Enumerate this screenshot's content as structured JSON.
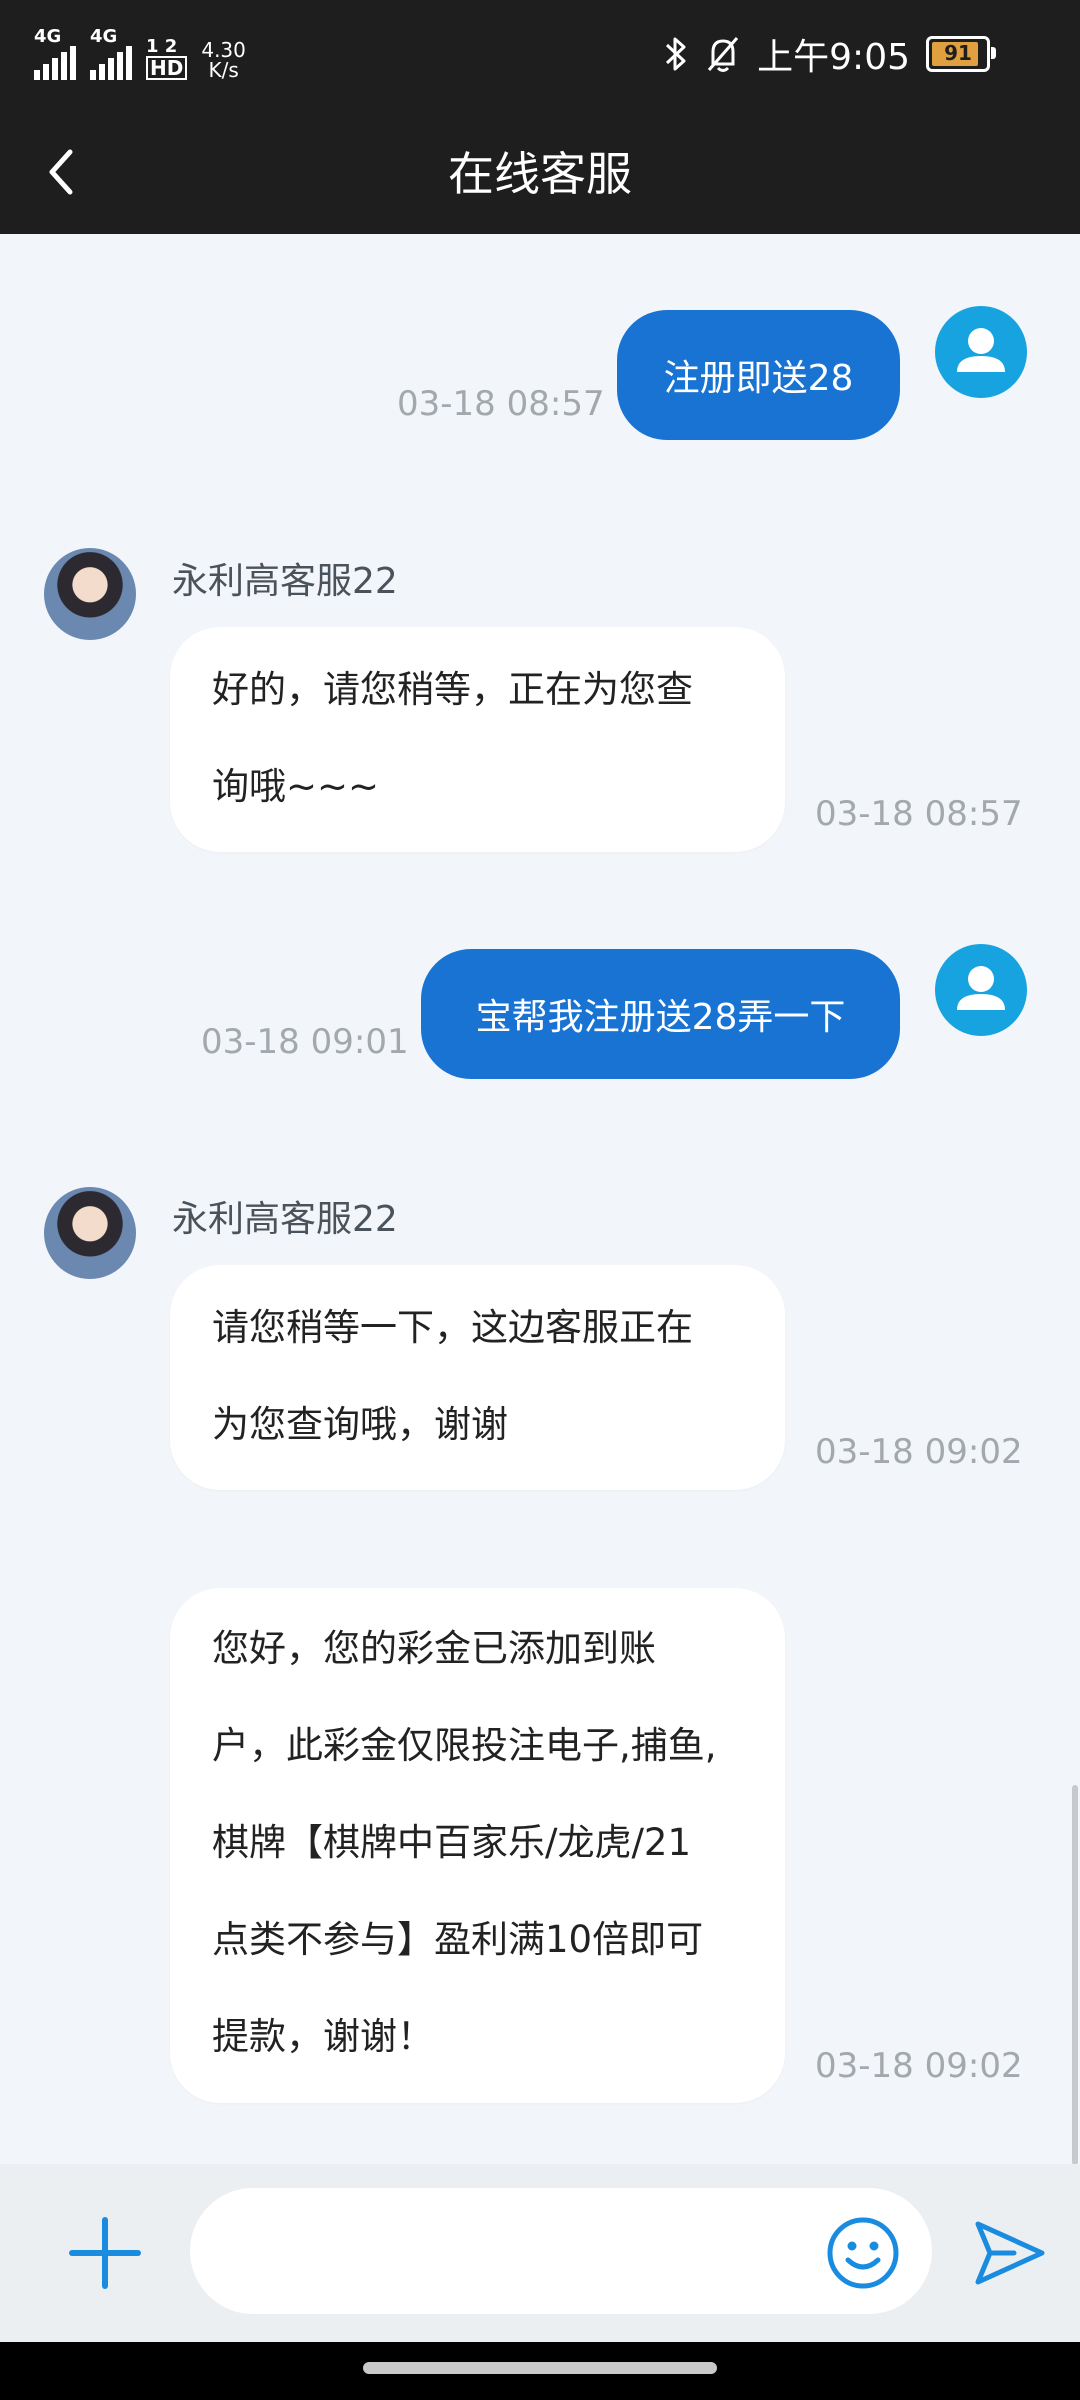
{
  "status_bar": {
    "signal1": "4G",
    "signal2": "4G",
    "hd_label": "HD",
    "hd_top": "1 2",
    "net_speed_value": "4.30",
    "net_speed_unit": "K/s",
    "time": "上午9:05",
    "battery": "91",
    "icons": [
      "bluetooth-icon",
      "bell-muted-icon"
    ]
  },
  "header": {
    "title": "在线客服",
    "back_icon": "chevron-left-icon"
  },
  "messages": [
    {
      "side": "out",
      "text": "注册即送28",
      "time": "03-18 08:57"
    },
    {
      "side": "in",
      "sender": "永利高客服22",
      "lines": [
        "好的，请您稍等，正在为您查",
        "询哦~~~"
      ],
      "time": "03-18 08:57"
    },
    {
      "side": "out",
      "text": "宝帮我注册送28弄一下",
      "time": "03-18 09:01"
    },
    {
      "side": "in",
      "sender": "永利高客服22",
      "lines": [
        "请您稍等一下，这边客服正在",
        "为您查询哦，谢谢"
      ],
      "time": "03-18 09:02"
    },
    {
      "side": "in",
      "sender": "",
      "lines": [
        "您好，您的彩金已添加到账",
        "户，此彩金仅限投注电子,捕鱼,",
        "棋牌【棋牌中百家乐/龙虎/21",
        "点类不参与】盈利满10倍即可",
        "提款，谢谢！"
      ],
      "time": "03-18 09:02"
    }
  ],
  "input_bar": {
    "placeholder": "",
    "value": "",
    "icons": [
      "plus-icon",
      "emoji-icon",
      "send-icon"
    ]
  },
  "colors": {
    "header_bg": "#1e1e1e",
    "chat_bg": "#f2f5f9",
    "outgoing_bubble": "#1873d3",
    "accent": "#1a8ce0",
    "user_avatar": "#17a3e0"
  }
}
